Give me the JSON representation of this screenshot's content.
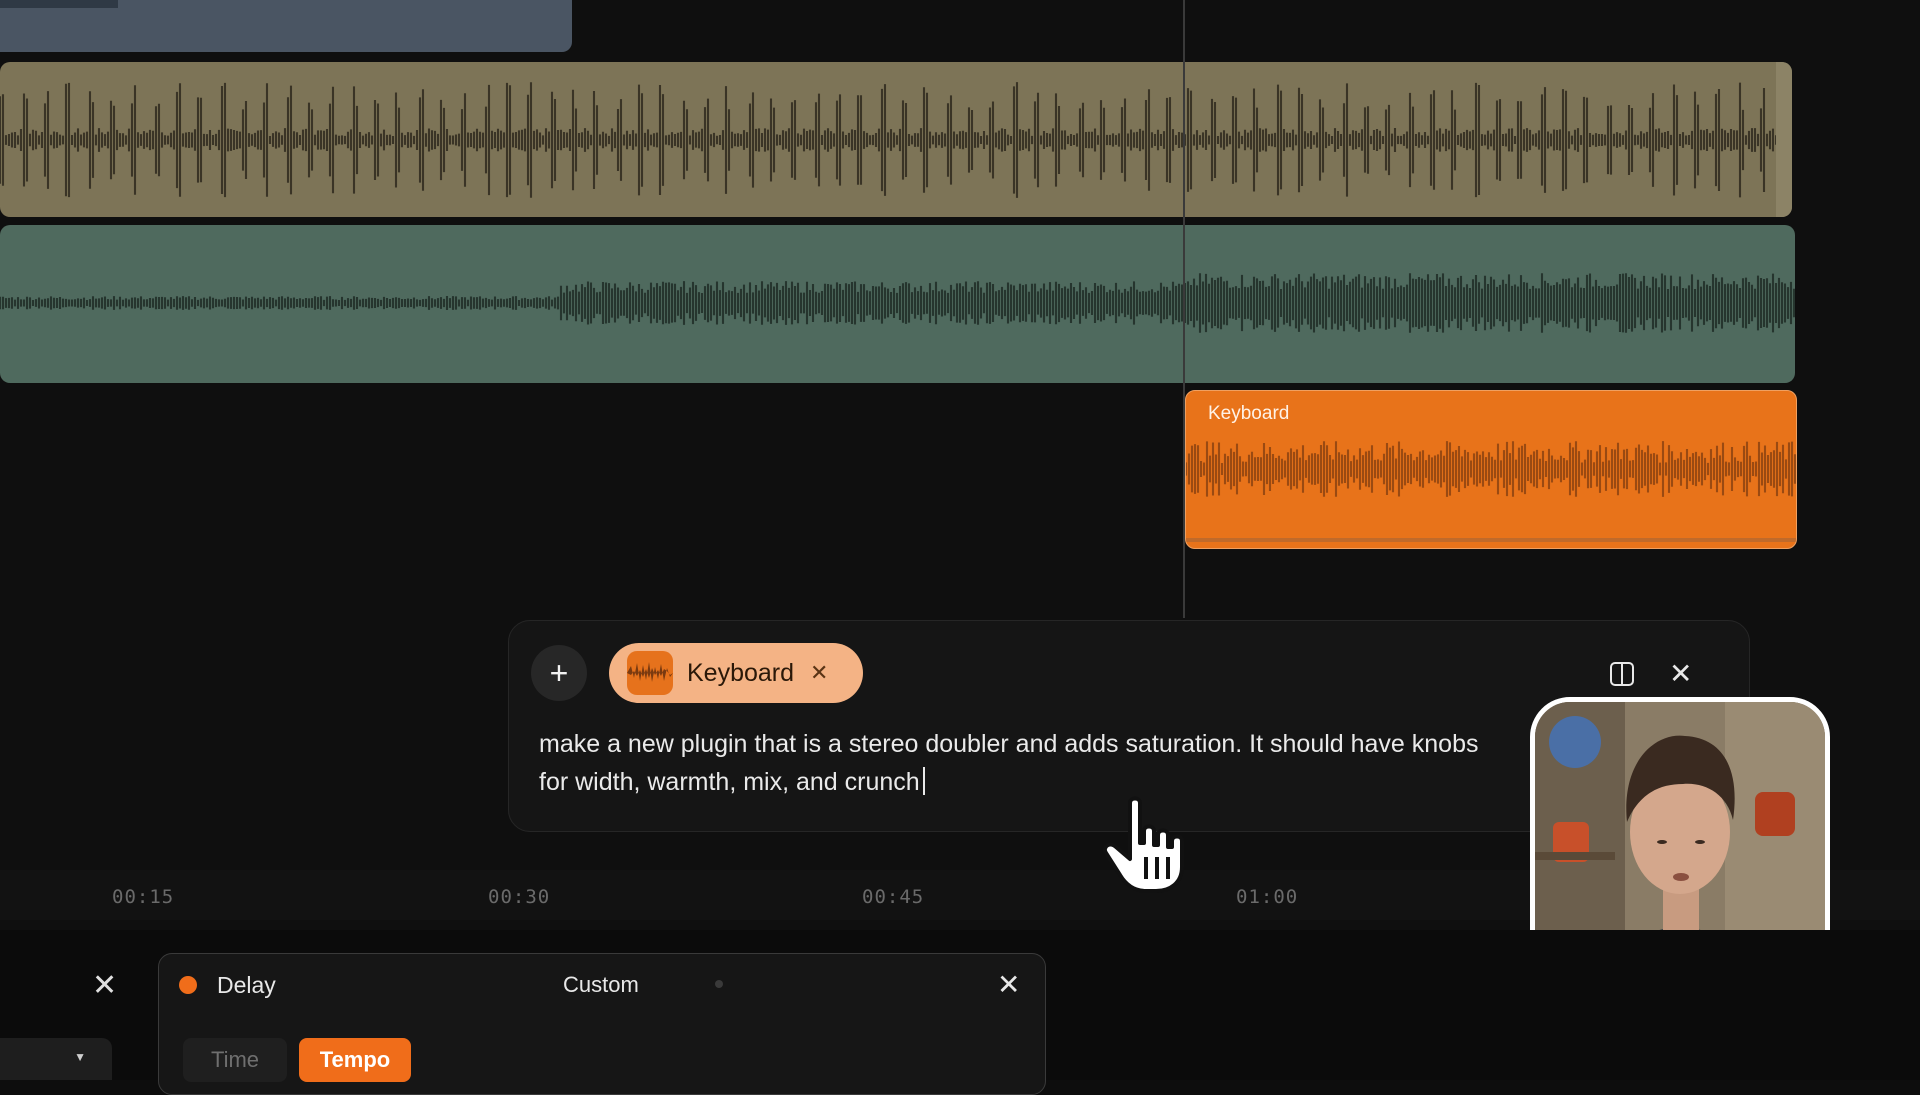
{
  "colors": {
    "accent_orange": "#e8731a",
    "chip_bg": "#f4b385",
    "background": "#0d0d0d"
  },
  "timeline": {
    "clips": [
      {
        "name": "",
        "color": "#4a5563"
      },
      {
        "name": "",
        "color": "#7d7457"
      },
      {
        "name": "",
        "color": "#4f6a5e"
      },
      {
        "name": "Keyboard",
        "color": "#e8731a"
      }
    ],
    "ruler": [
      "00:15",
      "00:30",
      "00:45",
      "01:00"
    ]
  },
  "prompt": {
    "add_icon": "plus-icon",
    "attachment": {
      "label": "Keyboard",
      "close_icon": "close-icon"
    },
    "text": "make a new plugin that is a stereo doubler and adds saturation. It should have knobs for width, warmth, mix, and crunch",
    "split_icon": "split-view-icon",
    "close_icon": "close-icon"
  },
  "delay_panel": {
    "title": "Delay",
    "preset": "Custom",
    "segments": [
      "Time",
      "Tempo"
    ],
    "selected_segment": "Tempo"
  }
}
